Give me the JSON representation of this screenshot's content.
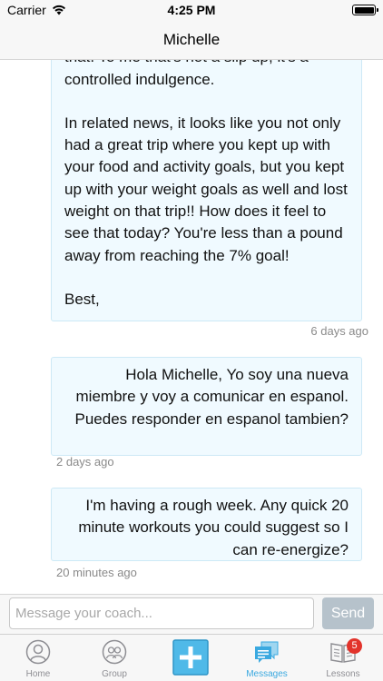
{
  "status_bar": {
    "carrier": "Carrier",
    "time": "4:25 PM"
  },
  "nav": {
    "title": "Michelle"
  },
  "messages": [
    {
      "lines_a": "delicious way and taking a few bites to do that. To me that's not a slip up, it's a controlled indulgence.",
      "lines_b": "In related news, it looks like you not only had a great trip where you kept up with your food and activity goals, but you kept up with your weight goals as well and lost weight on that trip!! How does it feel to see that today? You're less than a pound away from reaching the 7% goal!",
      "lines_c": "Best,",
      "timestamp": "6 days ago"
    },
    {
      "text": "Hola Michelle, Yo soy una nueva miembre y voy a comunicar en espanol. Puedes responder en espanol tambien?",
      "timestamp": "2 days ago"
    },
    {
      "text": "I'm having a rough week. Any quick 20 minute workouts you could suggest so I can re-energize?",
      "timestamp": "20 minutes ago"
    }
  ],
  "composer": {
    "placeholder": "Message your coach...",
    "send_label": "Send"
  },
  "tabs": [
    {
      "label": "Home",
      "icon": "person-icon"
    },
    {
      "label": "Group",
      "icon": "group-icon"
    },
    {
      "label": "",
      "icon": "plus-icon"
    },
    {
      "label": "Messages",
      "icon": "messages-icon",
      "active": true
    },
    {
      "label": "Lessons",
      "icon": "book-icon",
      "badge": "5"
    }
  ],
  "colors": {
    "accent": "#3aa9e0",
    "bubble_bg": "#f0faff",
    "bubble_border": "#cde9f6",
    "send_disabled": "#b6c2cb",
    "badge": "#e2332b"
  }
}
